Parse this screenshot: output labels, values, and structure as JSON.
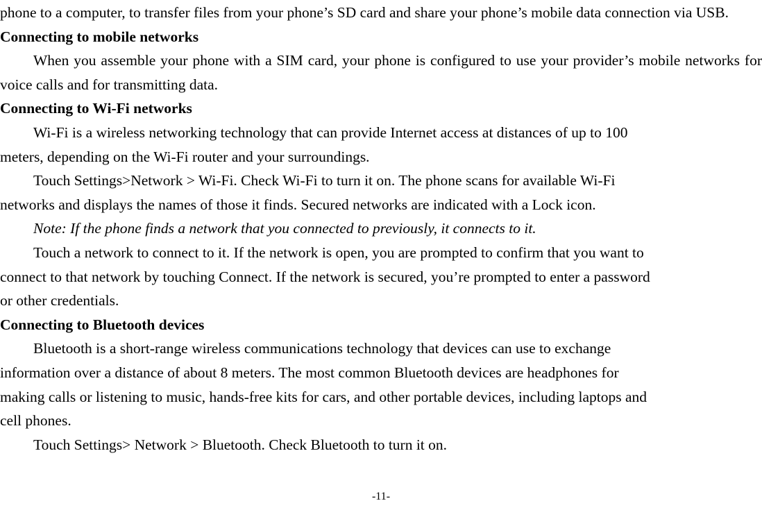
{
  "document": {
    "page_footer": "-11-",
    "blocks": [
      {
        "id": "intro_paragraph",
        "type": "paragraph_justified",
        "lines": [
          "phone to a computer, to transfer files from your phone’s SD card and share your phone’s mobile data",
          "connection via USB."
        ],
        "text": "phone to a computer, to transfer files from your phone’s SD card and share your phone’s mobile data connection via USB."
      },
      {
        "id": "heading_mobile_networks",
        "type": "heading",
        "text": "Connecting to mobile networks"
      },
      {
        "id": "mobile_networks_paragraph",
        "type": "paragraph_justified",
        "lines": [
          "When you assemble your phone with a SIM card, your phone is configured to use your provider’s",
          "mobile networks for voice calls and for transmitting data."
        ],
        "text": "When you assemble your phone with a SIM card, your phone is configured to use your provider’s mobile networks for voice calls and for transmitting data."
      },
      {
        "id": "heading_wifi_networks",
        "type": "heading",
        "text": "Connecting to Wi-Fi networks"
      },
      {
        "id": "wifi_paragraph_1",
        "type": "paragraph_flow",
        "lines": [
          "Wi-Fi is a wireless networking technology that can provide Internet access at distances of up to 100",
          "meters, depending on the Wi-Fi router and your surroundings."
        ],
        "text": "Wi-Fi is a wireless networking technology that can provide Internet access at distances of up to 100 meters, depending on the Wi-Fi router and your surroundings."
      },
      {
        "id": "wifi_paragraph_2",
        "type": "paragraph_flow",
        "lines": [
          "Touch Settings>Network > Wi-Fi. Check Wi-Fi to turn it on. The phone scans for available Wi-Fi",
          "networks and displays the names of those it finds. Secured networks are indicated with a Lock icon."
        ],
        "text": "Touch Settings>Network > Wi-Fi. Check Wi-Fi to turn it on. The phone scans for available Wi-Fi networks and displays the names of those it finds. Secured networks are indicated with a Lock icon."
      },
      {
        "id": "wifi_note",
        "type": "note_italic",
        "lines": [
          "Note: If the phone finds a network that you connected to previously, it connects to it."
        ],
        "text": "Note: If the phone finds a network that you connected to previously, it connects to it."
      },
      {
        "id": "wifi_paragraph_3",
        "type": "paragraph_flow",
        "lines": [
          "Touch a network to connect to it. If the network is open, you are prompted to confirm that you want to",
          "connect to that network by touching Connect. If the network is secured, you’re prompted to enter a password",
          "or other credentials."
        ],
        "text": "Touch a network to connect to it. If the network is open, you are prompted to confirm that you want to connect to that network by touching Connect. If the network is secured, you’re prompted to enter a password or other credentials."
      },
      {
        "id": "heading_bluetooth_devices",
        "type": "heading",
        "text": "Connecting to Bluetooth devices"
      },
      {
        "id": "bluetooth_paragraph_1",
        "type": "paragraph_flow",
        "lines": [
          "Bluetooth is a short-range wireless communications technology that devices can use to exchange",
          "information over a distance of about 8 meters. The most common Bluetooth devices are headphones for",
          "making calls or listening to music, hands-free kits for cars, and other portable devices, including laptops and",
          "cell phones."
        ],
        "text": "Bluetooth is a short-range wireless communications technology that devices can use to exchange information over a distance of about 8 meters. The most common Bluetooth devices are headphones for making calls or listening to music, hands-free kits for cars, and other portable devices, including laptops and cell phones."
      },
      {
        "id": "bluetooth_paragraph_2",
        "type": "paragraph_flow",
        "lines": [
          "Touch Settings> Network > Bluetooth. Check Bluetooth to turn it on."
        ],
        "text": "Touch Settings> Network > Bluetooth. Check Bluetooth to turn it on."
      }
    ]
  }
}
